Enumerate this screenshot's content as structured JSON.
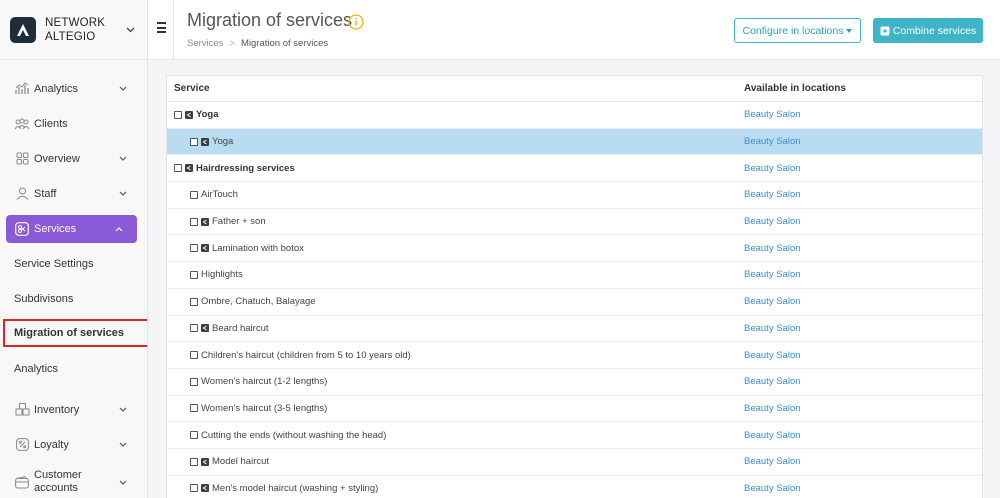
{
  "brand": {
    "line1": "NETWORK",
    "line2": "ALTEGIO"
  },
  "sidebar": {
    "items": [
      {
        "id": "analytics",
        "label": "Analytics",
        "icon": "chart-icon",
        "chevron": true
      },
      {
        "id": "clients",
        "label": "Clients",
        "icon": "people-icon",
        "chevron": false
      },
      {
        "id": "overview",
        "label": "Overview",
        "icon": "grid-icon",
        "chevron": true
      },
      {
        "id": "staff",
        "label": "Staff",
        "icon": "person-icon",
        "chevron": true
      },
      {
        "id": "services",
        "label": "Services",
        "icon": "scissors-icon",
        "chevron": true,
        "active": true
      }
    ],
    "subitems": [
      {
        "id": "service-settings",
        "label": "Service Settings"
      },
      {
        "id": "subdivisons",
        "label": "Subdivisons"
      },
      {
        "id": "migration",
        "label": "Migration of services",
        "current": true
      },
      {
        "id": "sub-analytics",
        "label": "Analytics"
      }
    ],
    "bottom_items": [
      {
        "id": "inventory",
        "label": "Inventory",
        "icon": "inventory-icon"
      },
      {
        "id": "loyalty",
        "label": "Loyalty",
        "icon": "percent-icon"
      },
      {
        "id": "customer-accounts",
        "label": "Customer accounts",
        "icon": "wallet-icon"
      }
    ]
  },
  "header": {
    "title": "Migration of services",
    "breadcrumb": {
      "parent": "Services",
      "current": "Migration of services"
    },
    "configure_label": "Configure in locations",
    "combine_label": "Combine services"
  },
  "table": {
    "headers": {
      "service": "Service",
      "locations": "Available in locations"
    },
    "rows": [
      {
        "name": "Yoga",
        "location": "Beauty Salon",
        "type": "group",
        "shared": true
      },
      {
        "name": "Yoga",
        "location": "Beauty Salon",
        "type": "child",
        "shared": true,
        "selected": true
      },
      {
        "name": "Hairdressing services",
        "location": "Beauty Salon",
        "type": "group",
        "shared": true
      },
      {
        "name": "AirTouch",
        "location": "Beauty Salon",
        "type": "child",
        "shared": false
      },
      {
        "name": "Father + son",
        "location": "Beauty Salon",
        "type": "child",
        "shared": true
      },
      {
        "name": "Lamination with botox",
        "location": "Beauty Salon",
        "type": "child",
        "shared": true
      },
      {
        "name": "Highlights",
        "location": "Beauty Salon",
        "type": "child",
        "shared": false
      },
      {
        "name": "Ombre, Chatuch, Balayage",
        "location": "Beauty Salon",
        "type": "child",
        "shared": false
      },
      {
        "name": "Beard haircut",
        "location": "Beauty Salon",
        "type": "child",
        "shared": true
      },
      {
        "name": "Children's haircut (children from 5 to 10 years old)",
        "location": "Beauty Salon",
        "type": "child",
        "shared": false
      },
      {
        "name": "Women's haircut (1-2 lengths)",
        "location": "Beauty Salon",
        "type": "child",
        "shared": false
      },
      {
        "name": "Women's haircut (3-5 lengths)",
        "location": "Beauty Salon",
        "type": "child",
        "shared": false
      },
      {
        "name": "Cutting the ends (without washing the head)",
        "location": "Beauty Salon",
        "type": "child",
        "shared": false
      },
      {
        "name": "Model haircut",
        "location": "Beauty Salon",
        "type": "child",
        "shared": true
      },
      {
        "name": "Men's model haircut (washing + styling)",
        "location": "Beauty Salon",
        "type": "child",
        "shared": true
      }
    ]
  },
  "colors": {
    "accent": "#8b5ad6",
    "teal": "#3eb4c6",
    "link": "#3a8fd1",
    "selected_row": "#b9dcf2",
    "highlight_box": "#e02424"
  }
}
